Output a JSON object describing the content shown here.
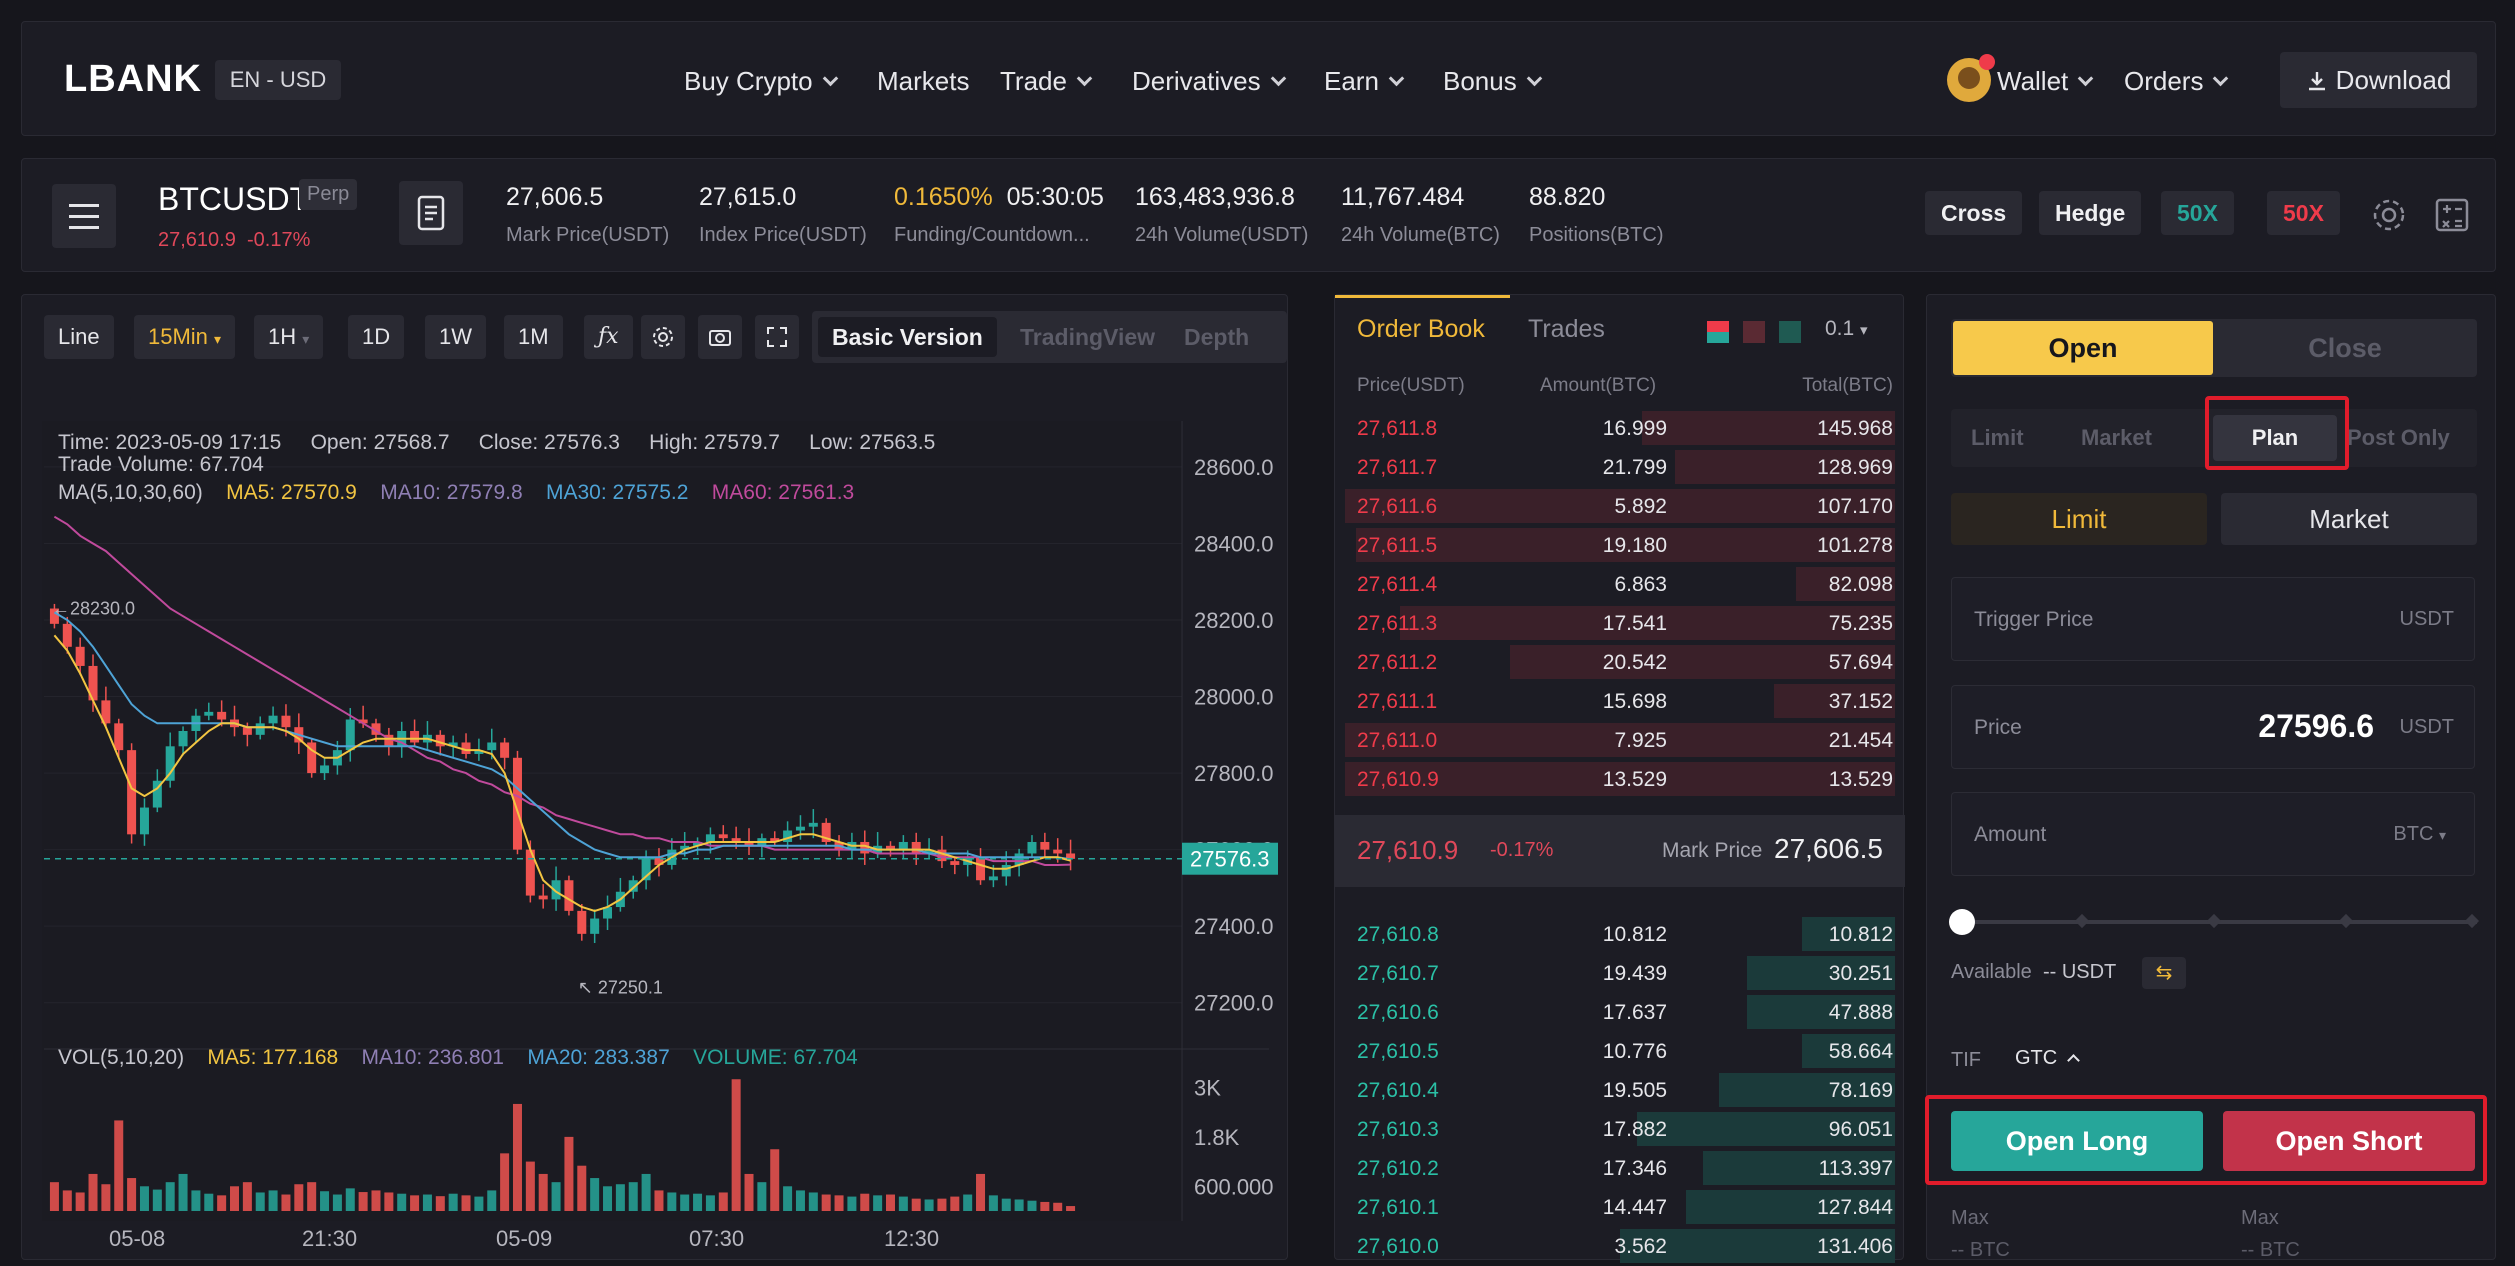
{
  "nav": {
    "logo": "LBANK",
    "lang": "EN - USD",
    "items": [
      "Buy Crypto",
      "Markets",
      "Trade",
      "Derivatives",
      "Earn",
      "Bonus"
    ],
    "wallet": "Wallet",
    "orders": "Orders",
    "download": "Download"
  },
  "ticker": {
    "symbol": "BTCUSDT",
    "badge": "Perp",
    "last_price": "27,610.9",
    "change": "-0.17%",
    "stats": [
      {
        "value": "27,606.5",
        "label": "Mark Price(USDT)"
      },
      {
        "value": "27,615.0",
        "label": "Index Price(USDT)"
      },
      {
        "value": "0.1650%",
        "value2": "05:30:05",
        "label": "Funding/Countdown..."
      },
      {
        "value": "163,483,936.8",
        "label": "24h Volume(USDT)"
      },
      {
        "value": "11,767.484",
        "label": "24h Volume(BTC)"
      },
      {
        "value": "88.820",
        "label": "Positions(BTC)"
      }
    ],
    "margin_mode": "Cross",
    "position_mode": "Hedge",
    "lev_long": "50X",
    "lev_short": "50X"
  },
  "chart_toolbar": {
    "buttons": [
      "Line",
      "15Min",
      "1H",
      "1D",
      "1W",
      "1M"
    ],
    "views": [
      "Basic Version",
      "TradingView",
      "Depth"
    ]
  },
  "chart_info": {
    "time": "Time: 2023-05-09 17:15",
    "open": "Open: 27568.7",
    "close": "Close: 27576.3",
    "high": "High: 27579.7",
    "low": "Low: 27563.5",
    "volume": "Trade Volume: 67.704",
    "ma_label": "MA(5,10,30,60)",
    "ma5": "MA5: 27570.9",
    "ma10": "MA10: 27579.8",
    "ma30": "MA30: 27575.2",
    "ma60": "MA60: 27561.3",
    "vol_label": "VOL(5,10,20)",
    "vma5": "MA5: 177.168",
    "vma10": "MA10: 236.801",
    "vma20": "MA20: 283.387",
    "vvol": "VOLUME: 67.704",
    "hi_mark": "28230.0",
    "lo_mark": "27250.1",
    "current_price": "27576.3"
  },
  "chart_data": {
    "type": "candlestick",
    "y_ticks": [
      "28600.0",
      "28400.0",
      "28200.0",
      "28000.0",
      "27800.0",
      "27600.0",
      "27400.0",
      "27200.0"
    ],
    "vol_ticks": [
      "3K",
      "1.8K",
      "600.000"
    ],
    "x_ticks": [
      "05-08",
      "21:30",
      "05-09",
      "07:30",
      "12:30"
    ],
    "ylim": [
      27100,
      28720
    ],
    "closes": [
      28190,
      28130,
      28080,
      27990,
      27930,
      27860,
      27640,
      27710,
      27780,
      27870,
      27910,
      27950,
      27960,
      27940,
      27920,
      27900,
      27930,
      27950,
      27920,
      27880,
      27800,
      27820,
      27860,
      27940,
      27930,
      27900,
      27870,
      27910,
      27880,
      27900,
      27870,
      27880,
      27850,
      27860,
      27880,
      27840,
      27600,
      27480,
      27470,
      27520,
      27440,
      27380,
      27420,
      27450,
      27490,
      27520,
      27580,
      27560,
      27600,
      27610,
      27620,
      27640,
      27630,
      27620,
      27610,
      27630,
      27620,
      27650,
      27660,
      27670,
      27620,
      27600,
      27620,
      27590,
      27610,
      27600,
      27620,
      27590,
      27600,
      27570,
      27560,
      27580,
      27520,
      27530,
      27560,
      27590,
      27620,
      27600,
      27590,
      27576
    ],
    "ma_short": [
      28160,
      28120,
      28060,
      27990,
      27920,
      27840,
      27760,
      27740,
      27760,
      27800,
      27850,
      27880,
      27910,
      27930,
      27930,
      27920,
      27920,
      27920,
      27910,
      27890,
      27860,
      27840,
      27840,
      27860,
      27880,
      27890,
      27890,
      27890,
      27890,
      27890,
      27880,
      27870,
      27860,
      27860,
      27850,
      27800,
      27700,
      27600,
      27520,
      27490,
      27470,
      27450,
      27440,
      27450,
      27470,
      27500,
      27530,
      27560,
      27580,
      27600,
      27610,
      27620,
      27620,
      27620,
      27620,
      27620,
      27620,
      27630,
      27640,
      27640,
      27630,
      27620,
      27610,
      27610,
      27600,
      27600,
      27600,
      27600,
      27600,
      27590,
      27580,
      27570,
      27560,
      27550,
      27550,
      27560,
      27570,
      27580,
      27580,
      27571
    ],
    "ma_mid": [
      28220,
      28200,
      28170,
      28130,
      28080,
      28030,
      27980,
      27950,
      27930,
      27930,
      27930,
      27930,
      27930,
      27930,
      27930,
      27920,
      27920,
      27920,
      27910,
      27900,
      27890,
      27880,
      27870,
      27870,
      27870,
      27870,
      27870,
      27870,
      27870,
      27860,
      27850,
      27840,
      27830,
      27820,
      27810,
      27790,
      27760,
      27730,
      27700,
      27670,
      27640,
      27620,
      27600,
      27590,
      27580,
      27580,
      27580,
      27580,
      27590,
      27590,
      27600,
      27600,
      27610,
      27610,
      27610,
      27610,
      27610,
      27610,
      27610,
      27610,
      27610,
      27610,
      27600,
      27600,
      27600,
      27600,
      27600,
      27600,
      27590,
      27590,
      27590,
      27590,
      27580,
      27580,
      27580,
      27580,
      27580,
      27580,
      27580,
      27575
    ],
    "ma_long": [
      28470,
      28450,
      28420,
      28400,
      28380,
      28350,
      28320,
      28290,
      28260,
      28230,
      28210,
      28190,
      28170,
      28150,
      28130,
      28110,
      28090,
      28070,
      28050,
      28030,
      28010,
      27990,
      27970,
      27950,
      27930,
      27910,
      27890,
      27880,
      27860,
      27840,
      27830,
      27810,
      27800,
      27780,
      27770,
      27750,
      27740,
      27720,
      27710,
      27690,
      27680,
      27670,
      27660,
      27650,
      27640,
      27640,
      27630,
      27630,
      27620,
      27620,
      27620,
      27610,
      27610,
      27610,
      27610,
      27610,
      27600,
      27600,
      27600,
      27600,
      27600,
      27600,
      27600,
      27600,
      27590,
      27590,
      27590,
      27590,
      27590,
      27580,
      27580,
      27580,
      27580,
      27570,
      27570,
      27570,
      27570,
      27560,
      27560,
      27561
    ],
    "volumes": [
      700,
      500,
      450,
      900,
      650,
      2200,
      800,
      600,
      520,
      700,
      900,
      500,
      420,
      380,
      600,
      700,
      450,
      500,
      400,
      650,
      700,
      480,
      400,
      550,
      460,
      500,
      450,
      420,
      380,
      400,
      360,
      420,
      380,
      350,
      500,
      1400,
      2600,
      1200,
      900,
      700,
      1800,
      1100,
      800,
      600,
      650,
      700,
      900,
      500,
      450,
      400,
      420,
      380,
      450,
      3200,
      900,
      700,
      1500,
      600,
      500,
      450,
      400,
      380,
      350,
      420,
      380,
      400,
      350,
      300,
      280,
      300,
      350,
      400,
      900,
      380,
      300,
      280,
      250,
      220,
      200,
      120
    ]
  },
  "orderbook": {
    "tabs": [
      "Order Book",
      "Trades"
    ],
    "precision": "0.1",
    "columns": [
      "Price(USDT)",
      "Amount(BTC)",
      "Total(BTC)"
    ],
    "asks": [
      {
        "price": "27,611.8",
        "amount": "16.999",
        "total": "145.968",
        "depth": 0.46
      },
      {
        "price": "27,611.7",
        "amount": "21.799",
        "total": "128.969",
        "depth": 0.4
      },
      {
        "price": "27,611.6",
        "amount": "5.892",
        "total": "107.170",
        "depth": 1.0
      },
      {
        "price": "27,611.5",
        "amount": "19.180",
        "total": "101.278",
        "depth": 0.98
      },
      {
        "price": "27,611.4",
        "amount": "6.863",
        "total": "82.098",
        "depth": 0.18
      },
      {
        "price": "27,611.3",
        "amount": "17.541",
        "total": "75.235",
        "depth": 0.9
      },
      {
        "price": "27,611.2",
        "amount": "20.542",
        "total": "57.694",
        "depth": 0.7
      },
      {
        "price": "27,611.1",
        "amount": "15.698",
        "total": "37.152",
        "depth": 0.22
      },
      {
        "price": "27,611.0",
        "amount": "7.925",
        "total": "21.454",
        "depth": 1.0
      },
      {
        "price": "27,610.9",
        "amount": "13.529",
        "total": "13.529",
        "depth": 1.0
      }
    ],
    "mid_price": "27,610.9",
    "mid_change": "-0.17%",
    "mark_label": "Mark Price",
    "mark_price": "27,606.5",
    "bids": [
      {
        "price": "27,610.8",
        "amount": "10.812",
        "total": "10.812",
        "depth": 0.17
      },
      {
        "price": "27,610.7",
        "amount": "19.439",
        "total": "30.251",
        "depth": 0.27
      },
      {
        "price": "27,610.6",
        "amount": "17.637",
        "total": "47.888",
        "depth": 0.27
      },
      {
        "price": "27,610.5",
        "amount": "10.776",
        "total": "58.664",
        "depth": 0.17
      },
      {
        "price": "27,610.4",
        "amount": "19.505",
        "total": "78.169",
        "depth": 0.32
      },
      {
        "price": "27,610.3",
        "amount": "17.882",
        "total": "96.051",
        "depth": 0.47
      },
      {
        "price": "27,610.2",
        "amount": "17.346",
        "total": "113.397",
        "depth": 0.35
      },
      {
        "price": "27,610.1",
        "amount": "14.447",
        "total": "127.844",
        "depth": 0.38
      },
      {
        "price": "27,610.0",
        "amount": "3.562",
        "total": "131.406",
        "depth": 0.5
      }
    ]
  },
  "form": {
    "open_tab": "Open",
    "close_tab": "Close",
    "order_types": [
      "Limit",
      "Market",
      "Plan",
      "Post Only"
    ],
    "sub_types": [
      "Limit",
      "Market"
    ],
    "trigger_label": "Trigger Price",
    "trigger_unit": "USDT",
    "price_label": "Price",
    "price_value": "27596.6",
    "price_unit": "USDT",
    "amount_label": "Amount",
    "amount_unit": "BTC",
    "available_label": "Available",
    "available_value": "-- USDT",
    "tif_label": "TIF",
    "tif_value": "GTC",
    "open_long": "Open Long",
    "open_short": "Open Short",
    "max_label_1": "Max",
    "max_label_2": "Max",
    "max_unit_1": "-- BTC",
    "max_unit_2": "-- BTC"
  },
  "colors": {
    "up": "#26a69a",
    "down": "#ef5350",
    "accent": "#f7c94b",
    "ma5": "#f2c542",
    "ma10": "#8f7fb4",
    "ma30": "#4ea3d6",
    "ma60": "#c04a9c"
  }
}
